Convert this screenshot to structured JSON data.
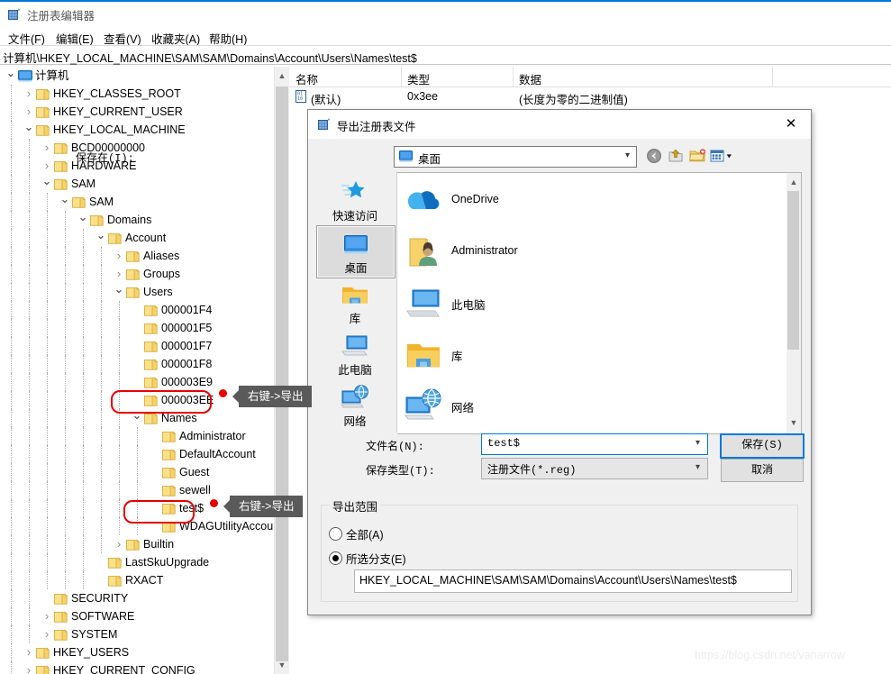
{
  "window": {
    "title": "注册表编辑器",
    "icon": "registry-editor-icon",
    "menu": [
      "文件(F)",
      "编辑(E)",
      "查看(V)",
      "收藏夹(A)",
      "帮助(H)"
    ],
    "address": "计算机\\HKEY_LOCAL_MACHINE\\SAM\\SAM\\Domains\\Account\\Users\\Names\\test$"
  },
  "tree": {
    "nodes": [
      {
        "label": "计算机",
        "depth": 0,
        "twisty": "open",
        "icon": "computer-icon"
      },
      {
        "label": "HKEY_CLASSES_ROOT",
        "depth": 1,
        "twisty": "closed",
        "icon": "folder-icon"
      },
      {
        "label": "HKEY_CURRENT_USER",
        "depth": 1,
        "twisty": "closed",
        "icon": "folder-icon"
      },
      {
        "label": "HKEY_LOCAL_MACHINE",
        "depth": 1,
        "twisty": "open",
        "icon": "folder-icon"
      },
      {
        "label": "BCD00000000",
        "depth": 2,
        "twisty": "closed",
        "icon": "folder-icon"
      },
      {
        "label": "HARDWARE",
        "depth": 2,
        "twisty": "closed",
        "icon": "folder-icon"
      },
      {
        "label": "SAM",
        "depth": 2,
        "twisty": "open",
        "icon": "folder-icon"
      },
      {
        "label": "SAM",
        "depth": 3,
        "twisty": "open",
        "icon": "folder-icon"
      },
      {
        "label": "Domains",
        "depth": 4,
        "twisty": "open",
        "icon": "folder-icon"
      },
      {
        "label": "Account",
        "depth": 5,
        "twisty": "open",
        "icon": "folder-icon"
      },
      {
        "label": "Aliases",
        "depth": 6,
        "twisty": "closed",
        "icon": "folder-icon"
      },
      {
        "label": "Groups",
        "depth": 6,
        "twisty": "closed",
        "icon": "folder-icon"
      },
      {
        "label": "Users",
        "depth": 6,
        "twisty": "open",
        "icon": "folder-icon"
      },
      {
        "label": "000001F4",
        "depth": 7,
        "twisty": "none",
        "icon": "folder-icon"
      },
      {
        "label": "000001F5",
        "depth": 7,
        "twisty": "none",
        "icon": "folder-icon"
      },
      {
        "label": "000001F7",
        "depth": 7,
        "twisty": "none",
        "icon": "folder-icon"
      },
      {
        "label": "000001F8",
        "depth": 7,
        "twisty": "none",
        "icon": "folder-icon"
      },
      {
        "label": "000003E9",
        "depth": 7,
        "twisty": "none",
        "icon": "folder-icon"
      },
      {
        "label": "000003EE",
        "depth": 7,
        "twisty": "none",
        "icon": "folder-icon"
      },
      {
        "label": "Names",
        "depth": 7,
        "twisty": "open",
        "icon": "folder-icon"
      },
      {
        "label": "Administrator",
        "depth": 8,
        "twisty": "none",
        "icon": "folder-icon"
      },
      {
        "label": "DefaultAccount",
        "depth": 8,
        "twisty": "none",
        "icon": "folder-icon"
      },
      {
        "label": "Guest",
        "depth": 8,
        "twisty": "none",
        "icon": "folder-icon"
      },
      {
        "label": "sewell",
        "depth": 8,
        "twisty": "none",
        "icon": "folder-icon"
      },
      {
        "label": "test$",
        "depth": 8,
        "twisty": "none",
        "icon": "folder-icon"
      },
      {
        "label": "WDAGUtilityAccount",
        "depth": 8,
        "twisty": "none",
        "icon": "folder-icon"
      },
      {
        "label": "Builtin",
        "depth": 6,
        "twisty": "closed",
        "icon": "folder-icon"
      },
      {
        "label": "LastSkuUpgrade",
        "depth": 5,
        "twisty": "none",
        "icon": "folder-icon"
      },
      {
        "label": "RXACT",
        "depth": 5,
        "twisty": "none",
        "icon": "folder-icon"
      },
      {
        "label": "SECURITY",
        "depth": 2,
        "twisty": "none",
        "icon": "folder-icon"
      },
      {
        "label": "SOFTWARE",
        "depth": 2,
        "twisty": "closed",
        "icon": "folder-icon"
      },
      {
        "label": "SYSTEM",
        "depth": 2,
        "twisty": "closed",
        "icon": "folder-icon"
      },
      {
        "label": "HKEY_USERS",
        "depth": 1,
        "twisty": "closed",
        "icon": "folder-icon"
      },
      {
        "label": "HKEY_CURRENT_CONFIG",
        "depth": 1,
        "twisty": "closed",
        "icon": "folder-icon"
      }
    ]
  },
  "values": {
    "columns": [
      "名称",
      "类型",
      "数据"
    ],
    "rows": [
      {
        "name": "(默认)",
        "type": "0x3ee",
        "data": "(长度为零的二进制值)",
        "icon": "binary-value-icon"
      }
    ]
  },
  "dialog": {
    "title": "导出注册表文件",
    "icon": "registry-editor-icon",
    "close_icon": "close-icon",
    "lookin_label": "保存在(I):",
    "lookin_value": "桌面",
    "lookin_icon": "desktop-icon",
    "toolbar": [
      {
        "name": "back-icon"
      },
      {
        "name": "up-one-level-icon"
      },
      {
        "name": "new-folder-icon"
      },
      {
        "name": "views-icon"
      }
    ],
    "places": [
      {
        "label": "快速访问",
        "icon": "quick-access-icon",
        "selected": false
      },
      {
        "label": "桌面",
        "icon": "desktop-icon",
        "selected": true
      },
      {
        "label": "库",
        "icon": "library-icon",
        "selected": false
      },
      {
        "label": "此电脑",
        "icon": "this-pc-icon",
        "selected": false
      },
      {
        "label": "网络",
        "icon": "network-icon",
        "selected": false
      }
    ],
    "files": [
      {
        "label": "OneDrive",
        "icon": "onedrive-icon"
      },
      {
        "label": "Administrator",
        "icon": "user-folder-icon"
      },
      {
        "label": "此电脑",
        "icon": "this-pc-icon"
      },
      {
        "label": "库",
        "icon": "library-icon"
      },
      {
        "label": "网络",
        "icon": "network-icon"
      }
    ],
    "filename_label": "文件名(N):",
    "filename_value": "test$",
    "filetype_label": "保存类型(T):",
    "filetype_value": "注册文件(*.reg)",
    "save_button": "保存(S)",
    "cancel_button": "取消",
    "export_range": {
      "group_title": "导出范围",
      "option_all": "全部(A)",
      "option_branch": "所选分支(E)",
      "selected": "branch",
      "branch_path": "HKEY_LOCAL_MACHINE\\SAM\\SAM\\Domains\\Account\\Users\\Names\\test$"
    }
  },
  "annotations": {
    "callout_1": "右键->导出",
    "callout_2": "右键->导出",
    "highlight_color": "#e60000"
  },
  "watermark": "https://blog.csdn.net/vanarrow"
}
